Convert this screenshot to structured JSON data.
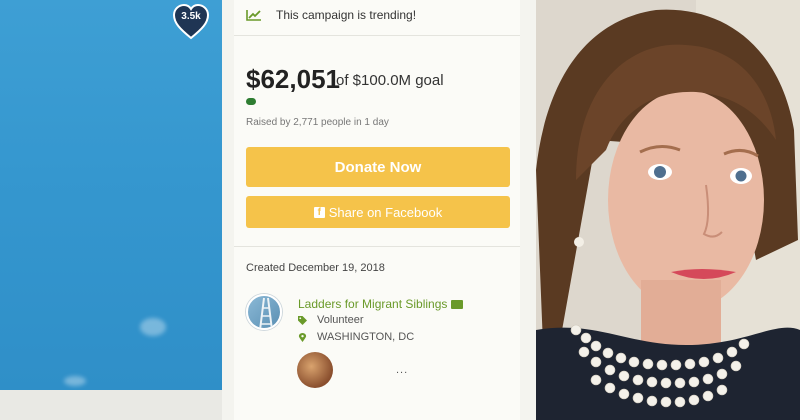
{
  "likes": {
    "count": "3.5k"
  },
  "campaign": {
    "trending_text": "This campaign is trending!",
    "amount_raised": "$62,051",
    "goal_text": "of $100.0M goal",
    "progress_fraction": 0.0006,
    "raised_by": "Raised by 2,771 people in 1 day",
    "donate_label": "Donate Now",
    "share_label": "Share on Facebook",
    "created": "Created December 19, 2018",
    "organizer": {
      "name": "Ladders for Migrant Siblings",
      "role": "Volunteer",
      "location": "WASHINGTON, DC"
    },
    "more": "..."
  },
  "colors": {
    "accent_yellow": "#f5c34a",
    "link_green": "#6a9a2a",
    "progress_green": "#2e7d32",
    "sky_blue": "#3597cf"
  },
  "icons": [
    "heart-icon",
    "trending-chart-icon",
    "facebook-icon",
    "envelope-icon",
    "tag-icon",
    "map-pin-icon"
  ]
}
